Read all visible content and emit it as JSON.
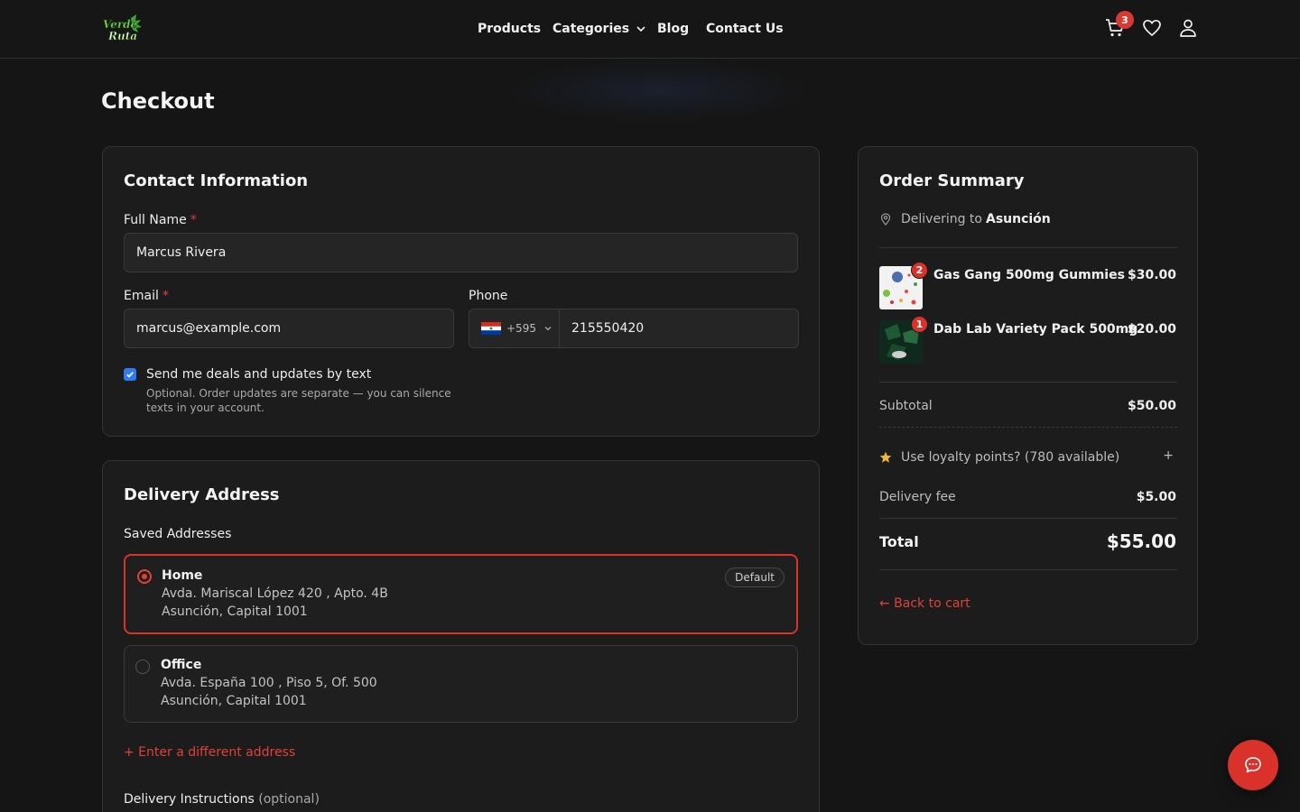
{
  "brand": {
    "name": "Verde Ruta",
    "accent": "#d9322b",
    "logo_green": "#4caf50"
  },
  "nav": {
    "products": "Products",
    "categories": "Categories",
    "blog": "Blog",
    "contact": "Contact Us"
  },
  "header": {
    "cart_count": "3",
    "icons": [
      "cart-icon",
      "heart-icon",
      "user-icon"
    ]
  },
  "page": {
    "title": "Checkout"
  },
  "contact": {
    "title": "Contact Information",
    "full_name_label": "Full Name",
    "full_name_value": "Marcus Rivera",
    "required_mark": "*",
    "email_label": "Email",
    "email_value": "marcus@example.com",
    "phone_label": "Phone",
    "phone_code": "+595",
    "phone_value": "215550420",
    "sms_checked": true,
    "sms_label": "Send me deals and updates by text",
    "sms_help": "Optional. Order updates are separate — you can silence texts in your account."
  },
  "delivery": {
    "title": "Delivery Address",
    "saved_label": "Saved Addresses",
    "addresses": [
      {
        "name": "Home",
        "line1": "Avda. Mariscal López 420 , Apto. 4B",
        "line2": "Asunción, Capital 1001",
        "badge": "Default",
        "selected": true
      },
      {
        "name": "Office",
        "line1": "Avda. España 100 , Piso 5, Of. 500",
        "line2": "Asunción, Capital 1001",
        "selected": false
      }
    ],
    "new_address": "+ Enter a different address",
    "instructions_label": "Delivery Instructions",
    "instructions_optional": "(optional)"
  },
  "summary": {
    "title": "Order Summary",
    "delivering_prefix": "Delivering to",
    "delivering_city": "Asunción",
    "items": [
      {
        "name": "Gas Gang 500mg Gummies",
        "price": "$30.00",
        "qty": "2"
      },
      {
        "name": "Dab Lab Variety Pack 500mg",
        "price": "$20.00",
        "qty": "1"
      }
    ],
    "subtotal_label": "Subtotal",
    "subtotal_value": "$50.00",
    "loyalty_label": "Use loyalty points? (780 available)",
    "loyalty_toggle": "+",
    "delivery_fee_label": "Delivery fee",
    "delivery_fee_value": "$5.00",
    "total_label": "Total",
    "total_value": "$55.00",
    "back_link": "← Back to cart"
  },
  "chat": {
    "icon": "chat-bubble-icon"
  }
}
